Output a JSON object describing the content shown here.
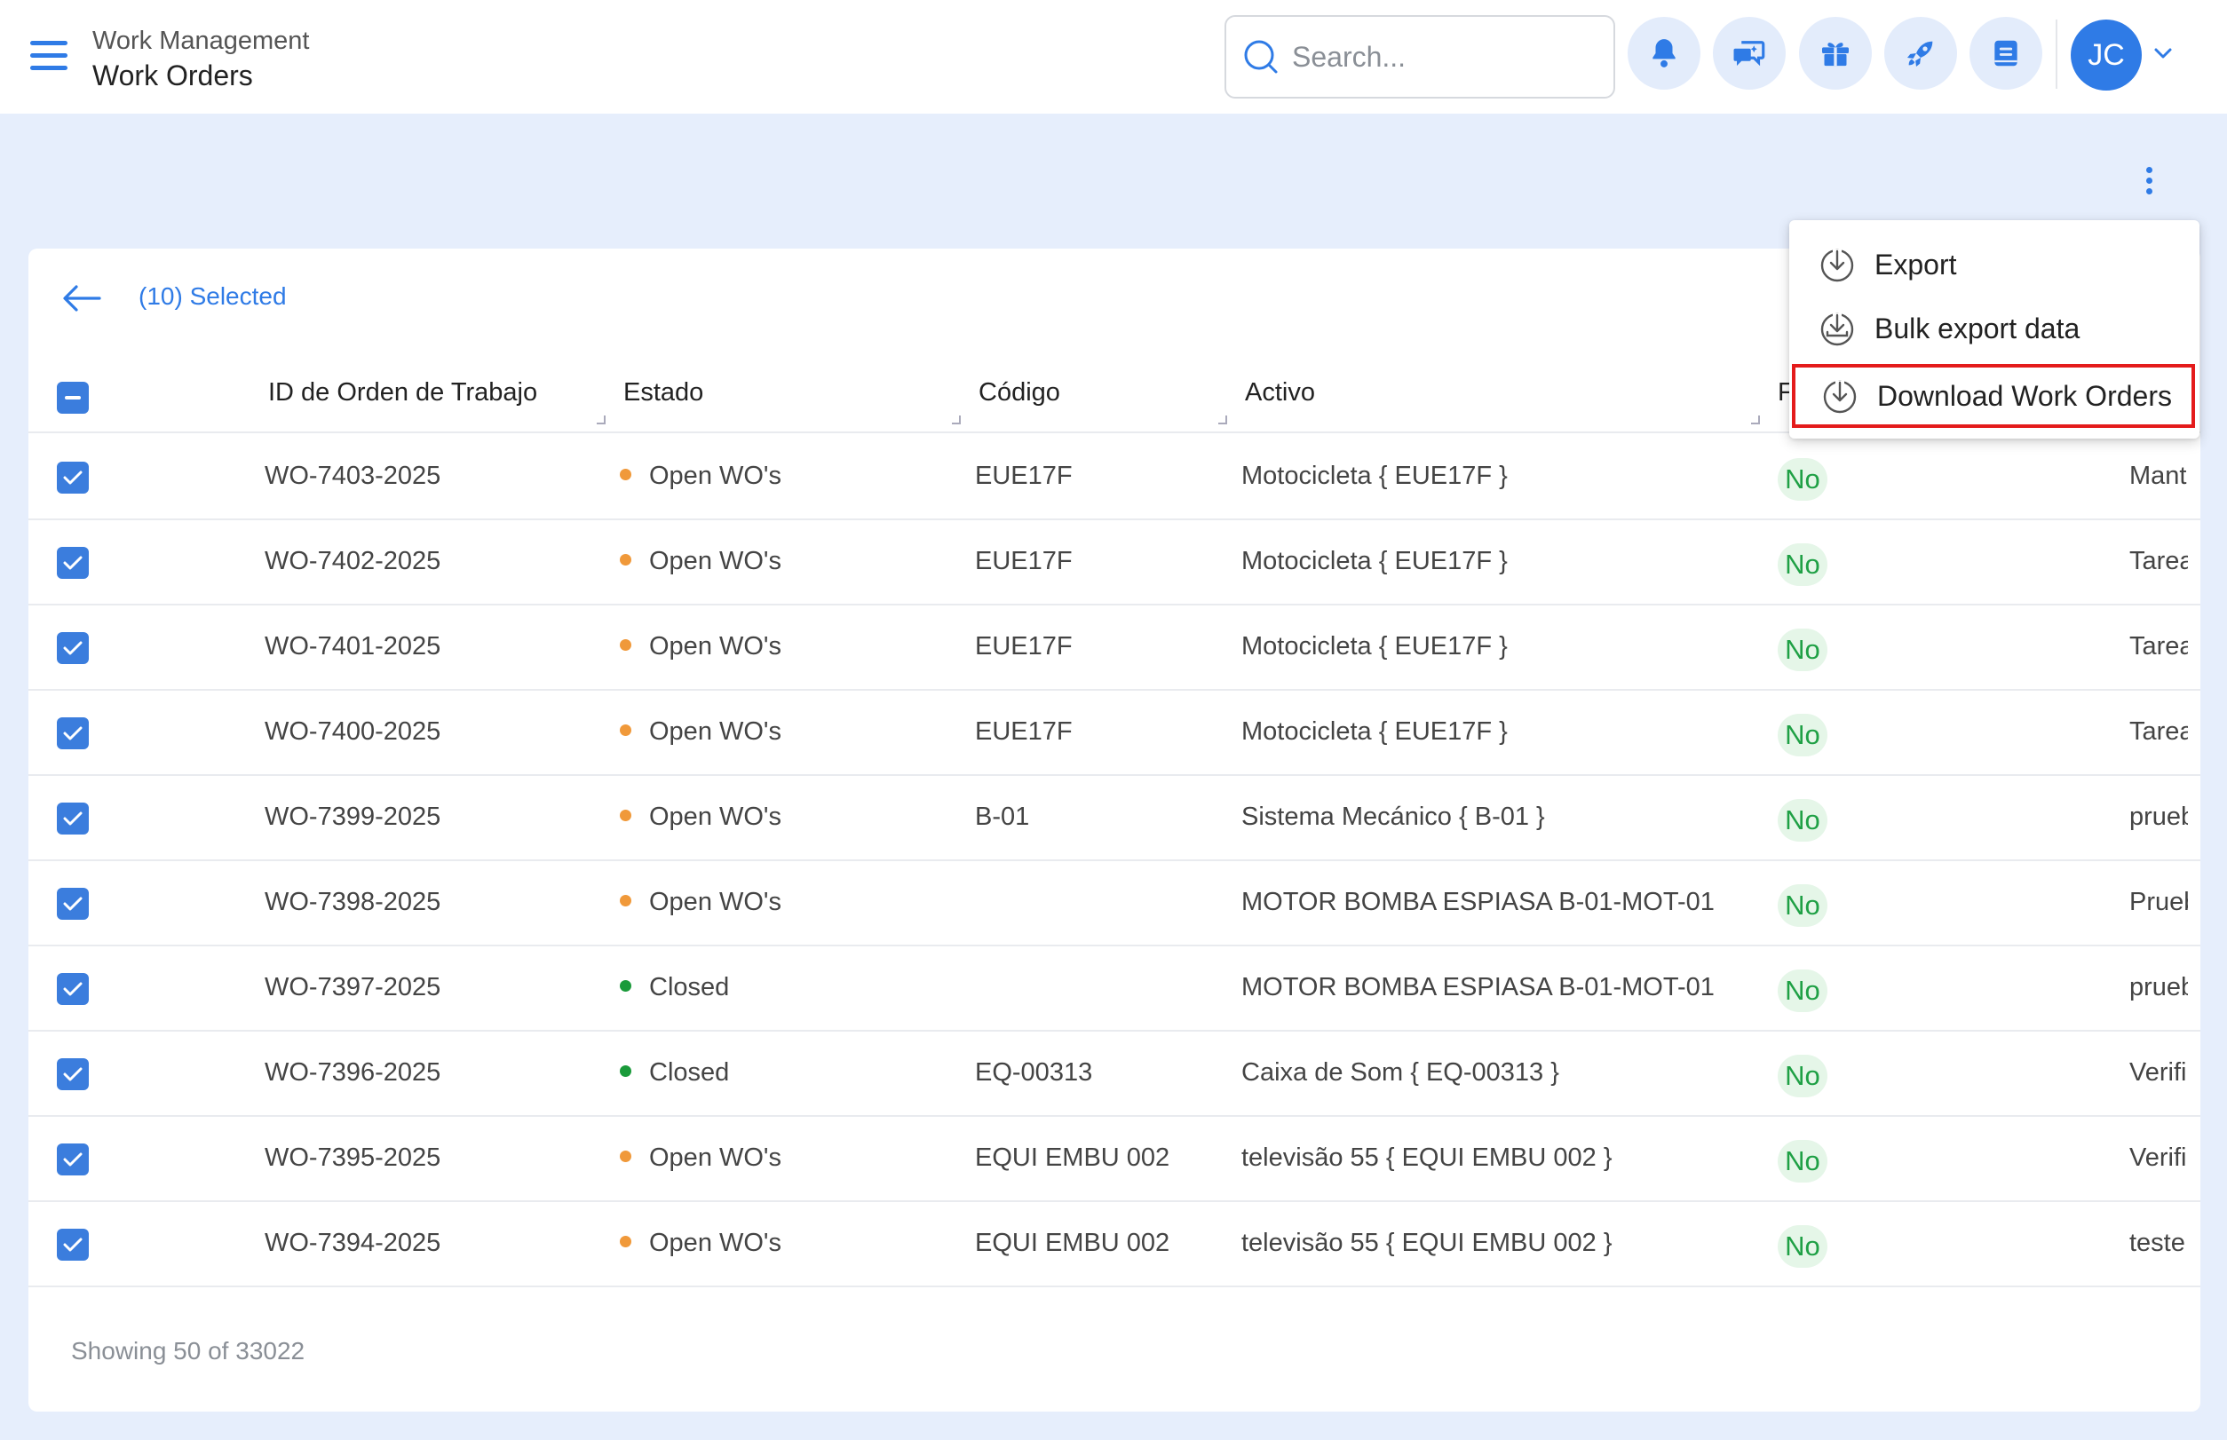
{
  "header": {
    "section": "Work Management",
    "title": "Work Orders",
    "search_placeholder": "Search...",
    "avatar_initials": "JC"
  },
  "selection": {
    "label": "(10) Selected"
  },
  "menu": {
    "items": [
      {
        "label": "Export",
        "icon": "download-icon"
      },
      {
        "label": "Bulk export data",
        "icon": "download-tray-icon"
      },
      {
        "label": "Download Work Orders",
        "icon": "download-icon",
        "highlighted": true
      }
    ]
  },
  "table": {
    "columns": [
      "ID de Orden de Trabajo",
      "Estado",
      "Código",
      "Activo",
      "F"
    ],
    "rows": [
      {
        "id": "WO-7403-2025",
        "estado": "Open WO's",
        "status": "open",
        "codigo": "EUE17F",
        "activo": "Motocicleta { EUE17F }",
        "flag": "No",
        "extra": "Mant"
      },
      {
        "id": "WO-7402-2025",
        "estado": "Open WO's",
        "status": "open",
        "codigo": "EUE17F",
        "activo": "Motocicleta { EUE17F }",
        "flag": "No",
        "extra": "Tarea"
      },
      {
        "id": "WO-7401-2025",
        "estado": "Open WO's",
        "status": "open",
        "codigo": "EUE17F",
        "activo": "Motocicleta { EUE17F }",
        "flag": "No",
        "extra": "Tarea"
      },
      {
        "id": "WO-7400-2025",
        "estado": "Open WO's",
        "status": "open",
        "codigo": "EUE17F",
        "activo": "Motocicleta { EUE17F }",
        "flag": "No",
        "extra": "Tarea"
      },
      {
        "id": "WO-7399-2025",
        "estado": "Open WO's",
        "status": "open",
        "codigo": "B-01",
        "activo": "Sistema Mecánico { B-01 }",
        "flag": "No",
        "extra": "prueb"
      },
      {
        "id": "WO-7398-2025",
        "estado": "Open WO's",
        "status": "open",
        "codigo": "",
        "activo": "MOTOR BOMBA ESPIASA B-01-MOT-01",
        "flag": "No",
        "extra": "Prueb"
      },
      {
        "id": "WO-7397-2025",
        "estado": "Closed",
        "status": "closed",
        "codigo": "",
        "activo": "MOTOR BOMBA ESPIASA B-01-MOT-01",
        "flag": "No",
        "extra": "prueb"
      },
      {
        "id": "WO-7396-2025",
        "estado": "Closed",
        "status": "closed",
        "codigo": "EQ-00313",
        "activo": "Caixa de Som { EQ-00313 }",
        "flag": "No",
        "extra": "Verifi"
      },
      {
        "id": "WO-7395-2025",
        "estado": "Open WO's",
        "status": "open",
        "codigo": "EQUI EMBU 002",
        "activo": "televisão 55 { EQUI EMBU 002 }",
        "flag": "No",
        "extra": "Verifi"
      },
      {
        "id": "WO-7394-2025",
        "estado": "Open WO's",
        "status": "open",
        "codigo": "EQUI EMBU 002",
        "activo": "televisão 55 { EQUI EMBU 002 }",
        "flag": "No",
        "extra": "teste"
      }
    ]
  },
  "footer": {
    "showing": "Showing 50 of 33022"
  },
  "colors": {
    "accent": "#2f7be6",
    "status_open": "#f0993a",
    "status_closed": "#1a9a3a",
    "badge_bg": "#e5f6e8",
    "badge_text": "#1fa045",
    "highlight": "#e41b1b"
  }
}
